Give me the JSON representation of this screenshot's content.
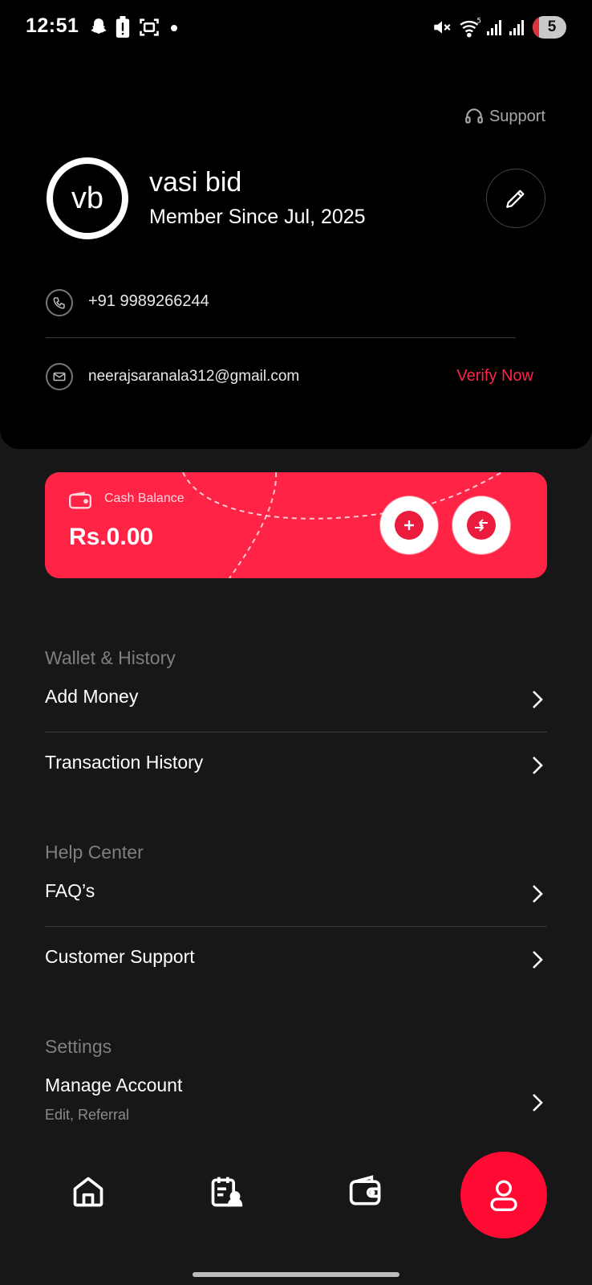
{
  "status_bar": {
    "time": "12:51",
    "battery": "5"
  },
  "profile": {
    "support_label": "Support",
    "avatar_initials": "vb",
    "name": "vasi bid",
    "member_since": "Member Since Jul, 2025",
    "phone": "+91 9989266244",
    "email": "neerajsaranala312@gmail.com",
    "verify_label": "Verify Now"
  },
  "cash": {
    "label": "Cash Balance",
    "value": "Rs.0.00"
  },
  "sections": {
    "wallet": {
      "title": "Wallet & History",
      "items": [
        {
          "label": "Add Money"
        },
        {
          "label": "Transaction History"
        }
      ]
    },
    "help": {
      "title": "Help Center",
      "items": [
        {
          "label": "FAQ’s"
        },
        {
          "label": "Customer Support"
        }
      ]
    },
    "settings": {
      "title": "Settings",
      "items": [
        {
          "label": "Manage Account",
          "sub": "Edit, Referral"
        }
      ]
    }
  },
  "nav": {
    "items": [
      "home-icon",
      "bids-icon",
      "wallet-icon",
      "profile-icon"
    ],
    "active": "profile-icon"
  },
  "colors": {
    "accent": "#ff2346",
    "background": "#171717",
    "header": "#000000"
  }
}
